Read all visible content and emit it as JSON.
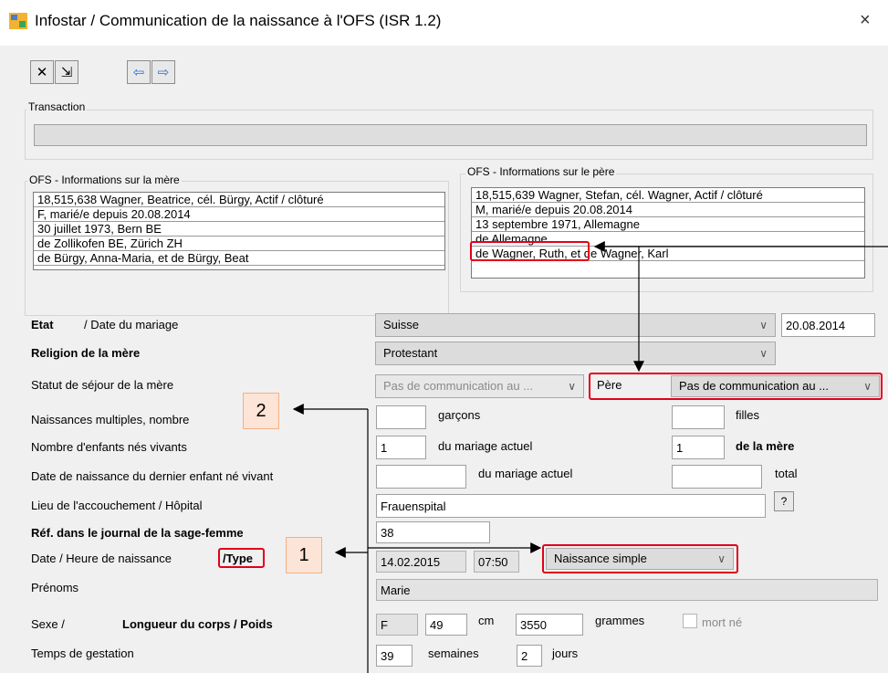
{
  "window": {
    "title": "Infostar / Communication de la naissance à l'OFS (ISR 1.2)",
    "close": "×"
  },
  "toolbar": {
    "cancel": "✕",
    "exit": "⇲",
    "prev": "⇦",
    "next": "⇨"
  },
  "transaction": {
    "label": "Transaction"
  },
  "mother": {
    "label": "OFS - Informations sur la mère",
    "lines": [
      "18,515,638  Wagner, Beatrice, cél. Bürgy, Actif / clôturé",
      "F, marié/e depuis 20.08.2014",
      "30 juillet 1973, Bern BE",
      "de Zollikofen BE, Zürich ZH",
      "de Bürgy, Anna-Maria, et de Bürgy, Beat"
    ]
  },
  "father": {
    "label": "OFS - Informations sur le père",
    "lines": [
      "18,515,639  Wagner, Stefan, cél. Wagner, Actif / clôturé",
      "M, marié/e depuis 20.08.2014",
      "13 septembre 1971, Allemagne",
      "de Allemagne",
      "de Wagner, Ruth, et de Wagner, Karl"
    ]
  },
  "form": {
    "etat_label": "Etat",
    "date_mariage_label": "/ Date du mariage",
    "etat_value": "Suisse",
    "date_mariage_value": "20.08.2014",
    "religion_label": "Religion de la mère",
    "religion_value": "Protestant",
    "statut_label": "Statut de séjour de la mère",
    "statut_value": "Pas de communication au ...",
    "pere_label": "Père",
    "pere_value": "Pas de communication au ...",
    "multiples_label": "Naissances multiples, nombre",
    "garcons_label": "garçons",
    "filles_label": "filles",
    "garcons_value": "",
    "filles_value": "",
    "enfants_label": "Nombre d'enfants nés vivants",
    "enfants_mariage_value": "1",
    "du_mariage_actuel": "du mariage actuel",
    "enfants_mere_value": "1",
    "de_la_mere": "de la mère",
    "dernier_label": "Date de naissance du dernier enfant né vivant",
    "dernier_value": "",
    "total_label": "total",
    "total_value": "",
    "lieu_label": "Lieu de l'accouchement / Hôpital",
    "lieu_value": "Frauenspital",
    "help": "?",
    "ref_label": "Réf. dans le journal de la sage-femme",
    "ref_value": "38",
    "date_heure_label": "Date / Heure de naissance",
    "type_label": "/Type",
    "date_value": "14.02.2015",
    "heure_value": "07:50",
    "type_value": "Naissance simple",
    "prenoms_label": "Prénoms",
    "prenoms_value": "Marie",
    "sexe_label": "Sexe /",
    "longueur_label": "Longueur du corps / Poids",
    "sexe_value": "F",
    "longueur_value": "49",
    "cm": "cm",
    "poids_value": "3550",
    "grammes": "grammes",
    "mort_ne": "mort né",
    "gestation_label": "Temps de gestation",
    "semaines_value": "39",
    "semaines": "semaines",
    "jours_value": "2",
    "jours": "jours"
  },
  "callouts": {
    "one": "1",
    "two": "2"
  }
}
